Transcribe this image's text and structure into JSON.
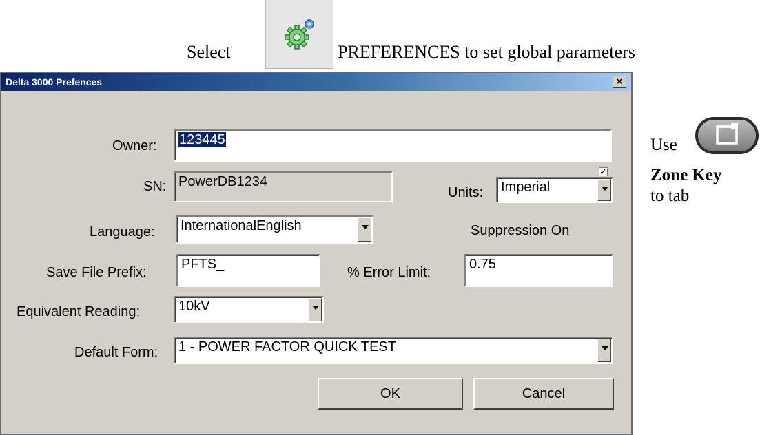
{
  "instruction": {
    "select_text": "Select",
    "preferences_text": "PREFERENCES to set global parameters",
    "preferences_icon": "gear-icon"
  },
  "dialog": {
    "title": "Delta 3000 Prefences",
    "close_glyph": "×",
    "owner": {
      "label": "Owner:",
      "value": "123445"
    },
    "sn": {
      "label": "SN:",
      "value": "PowerDB1234"
    },
    "units": {
      "label": "Units:",
      "value": "Imperial"
    },
    "language": {
      "label": "Language:",
      "value": "InternationalEnglish"
    },
    "suppression": {
      "label": "Suppression On",
      "checked": true,
      "glyph": "☑"
    },
    "save_file_prefix": {
      "label": "Save File Prefix:",
      "value": "PFTS_"
    },
    "error_limit": {
      "label": "% Error Limit:",
      "value": "0.75"
    },
    "equivalent_reading": {
      "label": "Equivalent Reading:",
      "value": "10kV"
    },
    "default_form": {
      "label": "Default Form:",
      "value": "1 - POWER FACTOR QUICK TEST"
    },
    "ok_label": "OK",
    "cancel_label": "Cancel",
    "colors": {
      "titlebar": "#0a246a",
      "face": "#d4d0c8"
    }
  },
  "side_note": {
    "use_text": "Use",
    "zone_key_text": "Zone Key",
    "to_tab_text": "to tab",
    "zone_icon": "zone-key-icon"
  }
}
